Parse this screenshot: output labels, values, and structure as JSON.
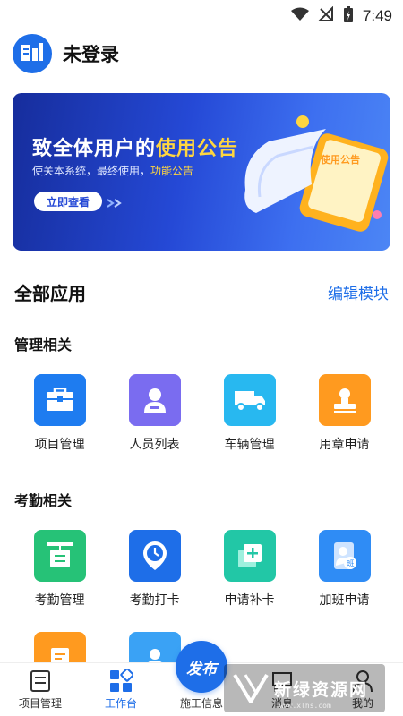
{
  "status_bar": {
    "time": "7:49"
  },
  "header": {
    "title": "未登录"
  },
  "banner": {
    "title_prefix": "致全体用户的",
    "title_highlight": "使用公告",
    "subtitle_prefix": "使关本系统，最终使用，",
    "subtitle_highlight": "功能公告",
    "button_label": "立即查看",
    "illustration_text": "使用公告"
  },
  "all_apps": {
    "title": "全部应用",
    "edit_label": "编辑模块"
  },
  "groups": [
    {
      "title": "管理相关",
      "apps": [
        {
          "label": "项目管理",
          "color": "#1e7cf0",
          "icon": "briefcase-icon"
        },
        {
          "label": "人员列表",
          "color": "#7a6cf0",
          "icon": "person-icon"
        },
        {
          "label": "车辆管理",
          "color": "#28b8f0",
          "icon": "truck-icon"
        },
        {
          "label": "用章申请",
          "color": "#ff9a1f",
          "icon": "stamp-icon"
        }
      ]
    },
    {
      "title": "考勤相关",
      "apps": [
        {
          "label": "考勤管理",
          "color": "#26c277",
          "icon": "signboard-icon"
        },
        {
          "label": "考勤打卡",
          "color": "#1e6ee8",
          "icon": "clock-pin-icon"
        },
        {
          "label": "申请补卡",
          "color": "#22c7a6",
          "icon": "add-card-icon"
        },
        {
          "label": "加班申请",
          "color": "#2f8cf5",
          "icon": "overtime-icon"
        }
      ]
    }
  ],
  "partial_apps": [
    {
      "color": "#ff9a1f",
      "icon": "document-icon"
    },
    {
      "color": "#3aa2f5",
      "icon": "person-card-icon"
    }
  ],
  "tabbar": {
    "items": [
      {
        "label": "项目管理",
        "icon": "document-list-icon",
        "active": false
      },
      {
        "label": "工作台",
        "icon": "grid-icon",
        "active": true
      },
      {
        "label": "施工信息",
        "icon": "construction-icon",
        "active": false
      },
      {
        "label": "消息",
        "icon": "message-icon",
        "active": false
      },
      {
        "label": "我的",
        "icon": "profile-icon",
        "active": false
      }
    ],
    "publish_label": "发布",
    "accent": "#1e6ee8"
  },
  "watermark": {
    "text": "新绿资源网",
    "url": "www.xlhs.com"
  }
}
